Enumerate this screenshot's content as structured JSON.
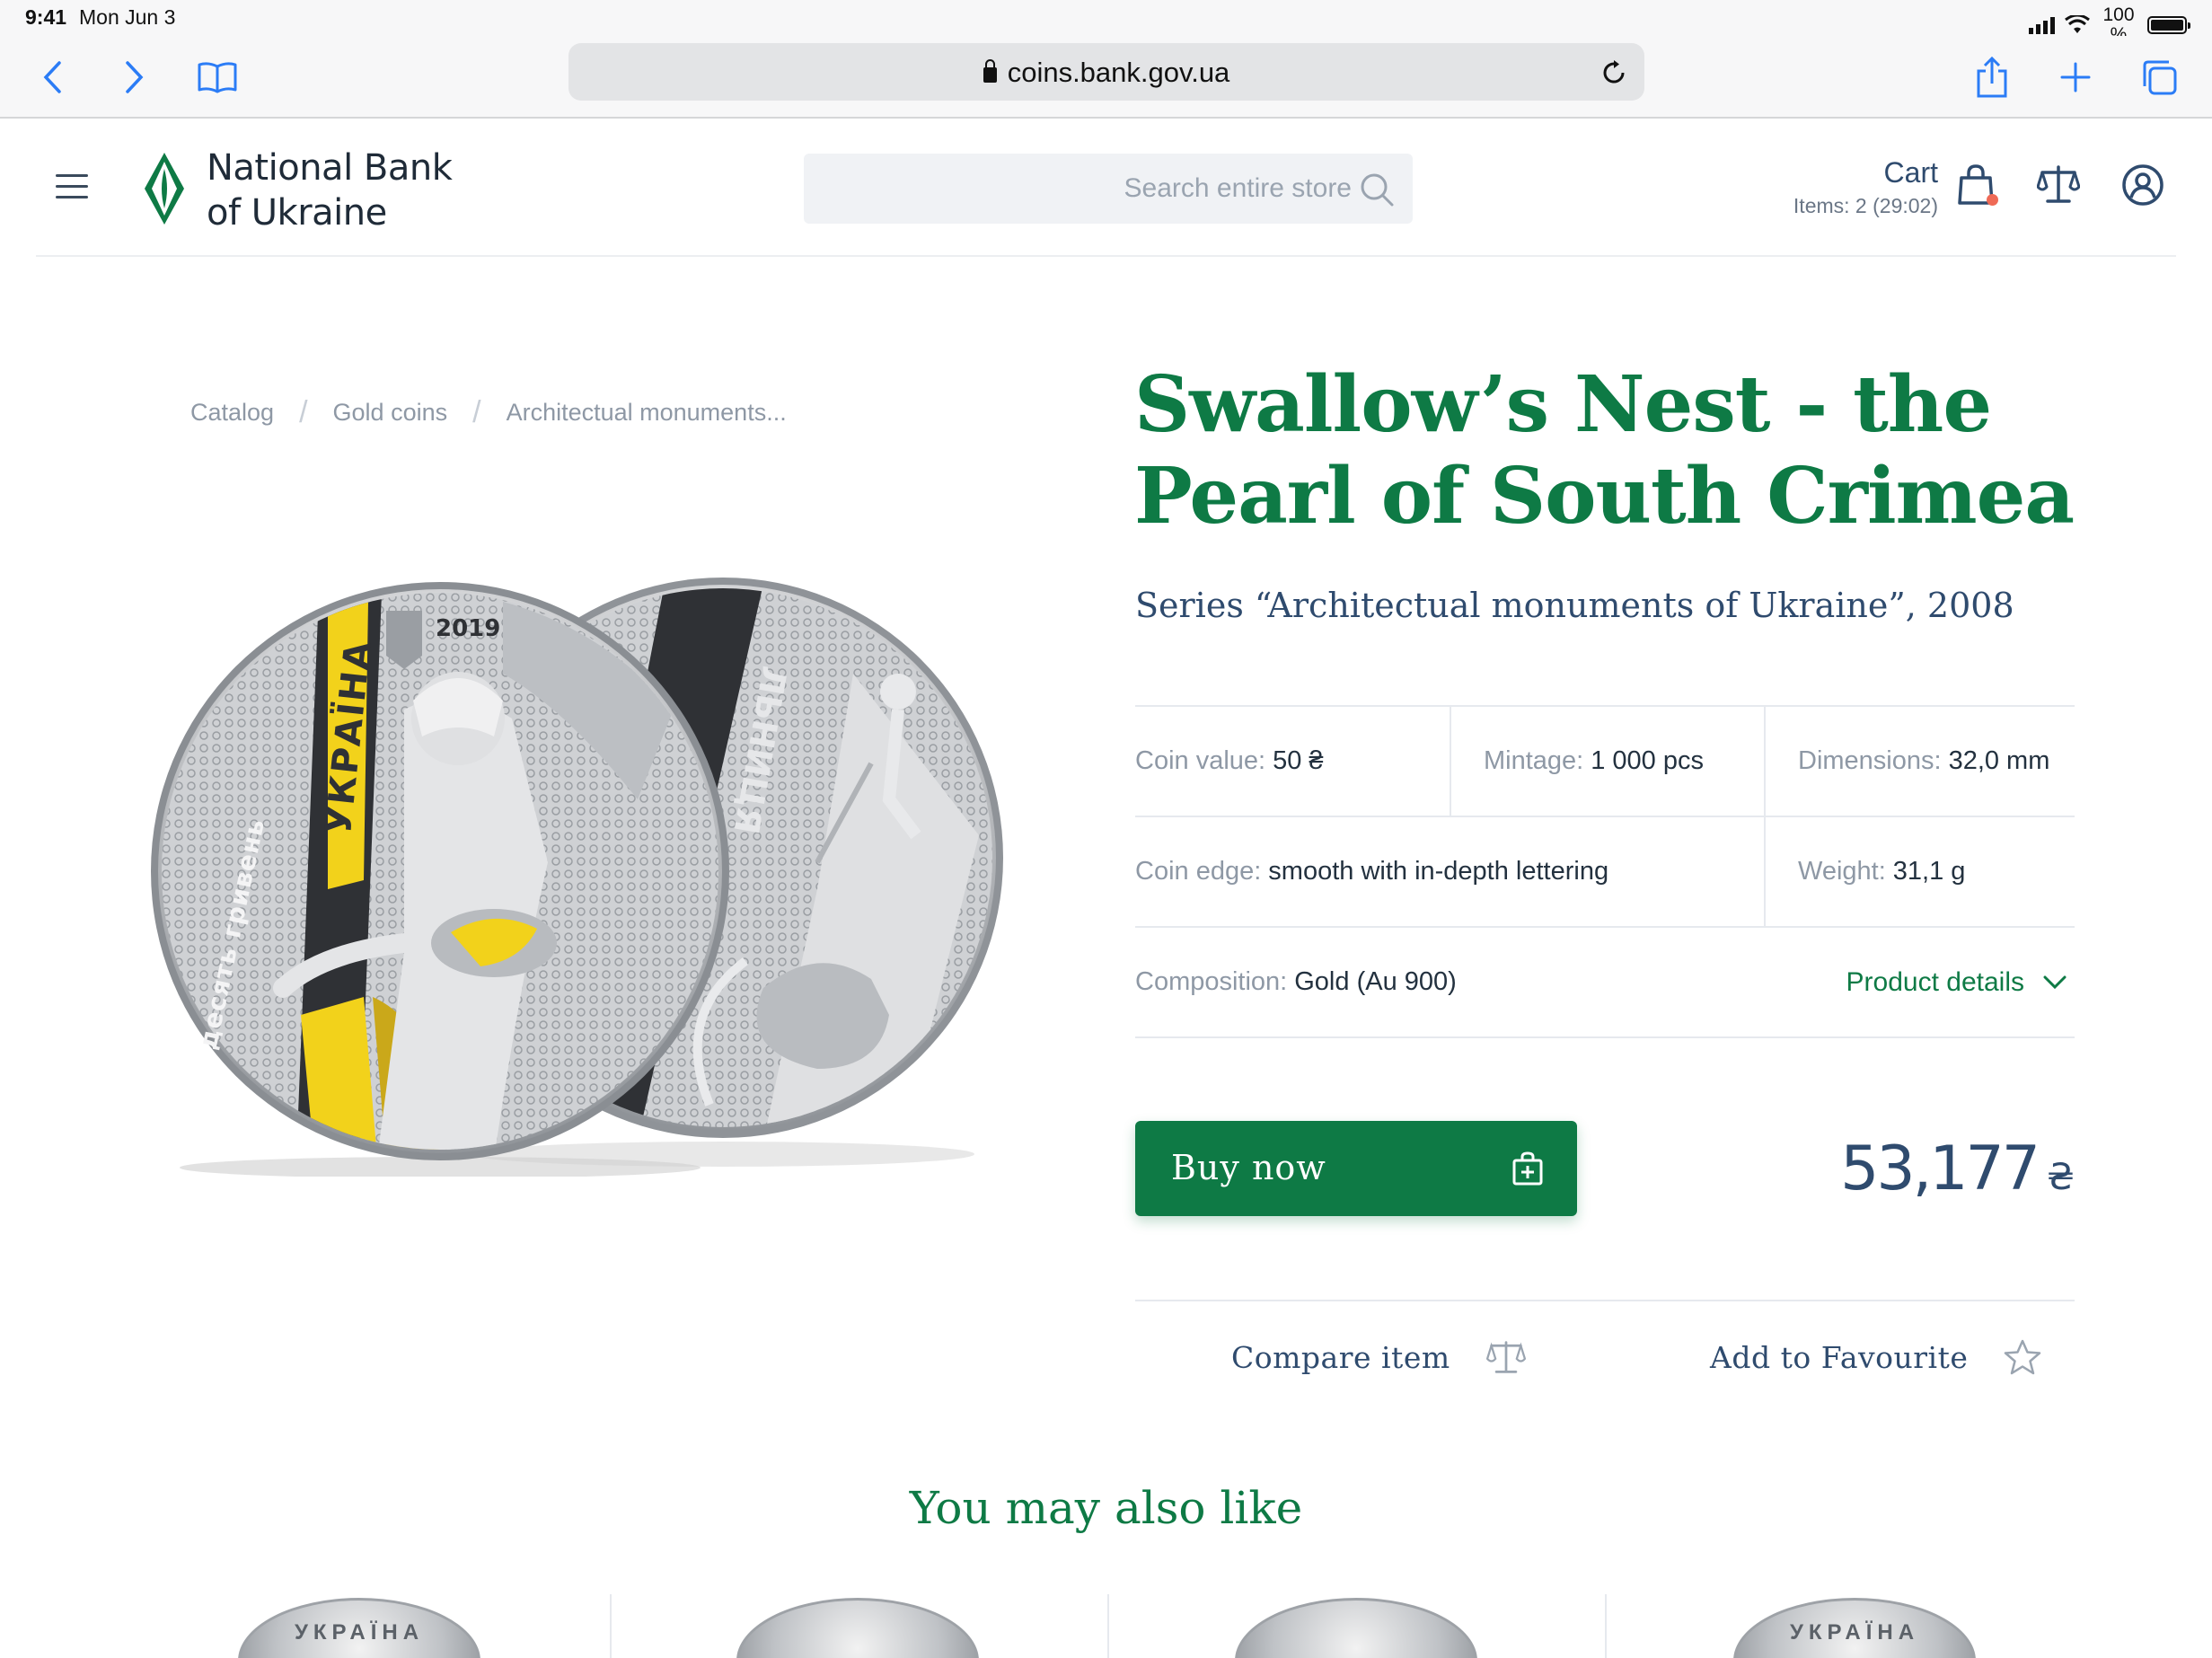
{
  "status_bar": {
    "time": "9:41",
    "date": "Mon Jun 3",
    "battery": "100 %"
  },
  "browser": {
    "url": "coins.bank.gov.ua"
  },
  "header": {
    "logo_line1": "National Bank",
    "logo_line2": "of Ukraine",
    "search_placeholder": "Search entire store",
    "cart_label": "Cart",
    "cart_items": "Items: 2 (29:02)"
  },
  "breadcrumb": [
    "Catalog",
    "Gold coins",
    "Architectual monuments..."
  ],
  "coin_art": {
    "year": "2019",
    "obverse_text": "УКРАЇНА",
    "obverse_denomination": "десять гривень",
    "reverse_text": "ЛЬНИЦЯ"
  },
  "product": {
    "title": "Swallow’s Nest - the Pearl of South Crimea",
    "series": "Series “Architectual monuments of Ukraine”, 2008",
    "specs": {
      "coin_value_label": "Coin value:",
      "coin_value": "50 ₴",
      "mintage_label": "Mintage:",
      "mintage": "1 000 pcs",
      "dimensions_label": "Dimensions:",
      "dimensions": "32,0 mm",
      "edge_label": "Coin edge:",
      "edge": "smooth with in-depth lettering",
      "weight_label": "Weight:",
      "weight": "31,1 g",
      "composition_label": "Composition:",
      "composition": "Gold (Au 900)"
    },
    "details_link": "Product details",
    "buy_label": "Buy now",
    "price": "53,177",
    "currency": "₴",
    "compare_label": "Compare item",
    "favourite_label": "Add to Favourite"
  },
  "related": {
    "heading": "You may also like",
    "thumb_texts": [
      "УКРАЇНА",
      "",
      "",
      "УКРАЇНА"
    ]
  },
  "colors": {
    "brand_green": "#0e7a45",
    "navy_text": "#2f4b6e",
    "cart_dot": "#ef6a56",
    "gold": "#f2d21b"
  }
}
